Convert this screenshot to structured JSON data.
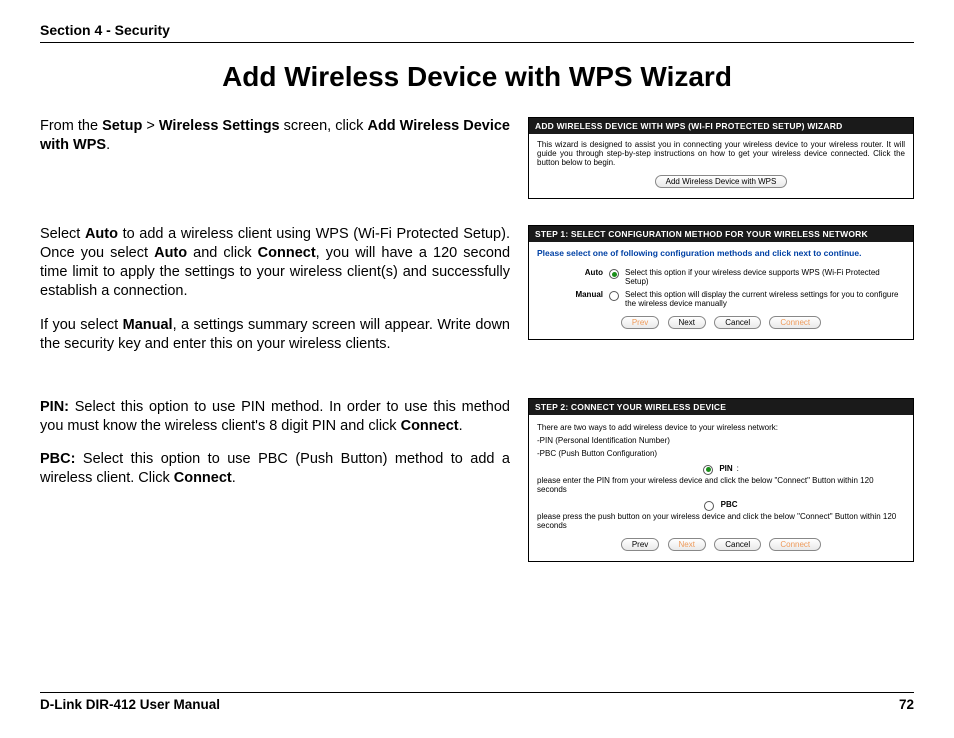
{
  "header": {
    "section": "Section 4 - Security"
  },
  "title": "Add Wireless Device with WPS Wizard",
  "para1": {
    "pre": "From the ",
    "b1": "Setup",
    "gt": " > ",
    "b2": "Wireless Settings",
    "mid": " screen, click ",
    "b3": "Add Wireless Device with WPS",
    "post": "."
  },
  "panel1": {
    "title": "ADD WIRELESS DEVICE WITH WPS (WI-FI PROTECTED SETUP) WIZARD",
    "body": "This wizard is designed to assist you in connecting your wireless device to your wireless router. It will guide you through step-by-step instructions on how to get your wireless device connected. Click the button below to begin.",
    "button": "Add Wireless Device with WPS"
  },
  "para2a": {
    "t1": "Select ",
    "b1": "Auto",
    "t2": " to add a wireless client using WPS (Wi-Fi Protected Setup). Once you select ",
    "b2": "Auto",
    "t3": " and click ",
    "b3": "Connect",
    "t4": ", you will have a 120 second time limit to apply the settings to your wireless client(s) and successfully establish a connection."
  },
  "para2b": {
    "t1": "If you select ",
    "b1": "Manual",
    "t2": ", a settings summary screen will appear. Write down the security key and enter this on your wireless clients."
  },
  "panel2": {
    "title": "STEP 1: SELECT CONFIGURATION METHOD FOR YOUR WIRELESS NETWORK",
    "instruction": "Please select one of following configuration methods and click next to continue.",
    "auto_label": "Auto",
    "auto_text": "Select this option if your wireless device supports WPS (Wi-Fi Protected Setup)",
    "manual_label": "Manual",
    "manual_text": "Select this option will display the current wireless settings for you to configure the wireless device manually",
    "buttons": {
      "prev": "Prev",
      "next": "Next",
      "cancel": "Cancel",
      "connect": "Connect"
    }
  },
  "para3a": {
    "b1": "PIN:",
    "t1": " Select this option to use PIN method. In order to use this method you must know the wireless client's 8 digit PIN and click ",
    "b2": "Connect",
    "t2": "."
  },
  "para3b": {
    "b1": "PBC:",
    "t1": " Select this option to use PBC (Push Button) method to add a wireless client. Click ",
    "b2": "Connect",
    "t2": "."
  },
  "panel3": {
    "title": "STEP 2: CONNECT YOUR WIRELESS DEVICE",
    "intro1": "There are two ways to add wireless device to your wireless network:",
    "intro2": "-PIN (Personal Identification Number)",
    "intro3": "-PBC (Push Button Configuration)",
    "pin_label": "PIN",
    "pin_note": "please enter the PIN from your wireless device and click the below \"Connect\" Button within 120 seconds",
    "pbc_label": "PBC",
    "pbc_note": "please press the push button on your wireless device and click the below \"Connect\" Button within 120 seconds",
    "buttons": {
      "prev": "Prev",
      "next": "Next",
      "cancel": "Cancel",
      "connect": "Connect"
    }
  },
  "footer": {
    "manual": "D-Link DIR-412 User Manual",
    "page": "72"
  }
}
